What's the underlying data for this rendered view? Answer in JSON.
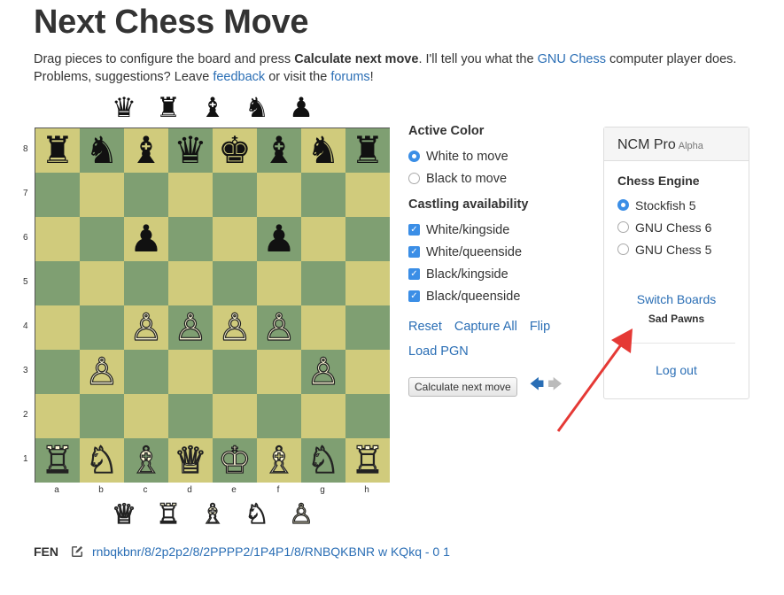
{
  "title": "Next Chess Move",
  "intro": {
    "part1": "Drag pieces to configure the board and press ",
    "bold": "Calculate next move",
    "part2": ". I'll tell you what the ",
    "gnu_link": "GNU Chess",
    "part3": " computer player does. Problems, suggestions? Leave ",
    "feedback_link": "feedback",
    "part4": " or visit the ",
    "forums_link": "forums",
    "part5": "!"
  },
  "spare_black": [
    "♛",
    "♜",
    "♝",
    "♞",
    "♟"
  ],
  "spare_white": [
    "♕",
    "♖",
    "♗",
    "♘",
    "♙"
  ],
  "board": {
    "rows": [
      [
        "♜",
        "♞",
        "♝",
        "♛",
        "♚",
        "♝",
        "♞",
        "♜"
      ],
      [
        "",
        "",
        "",
        "",
        "",
        "",
        "",
        ""
      ],
      [
        "",
        "",
        "♟",
        "",
        "",
        "♟",
        "",
        ""
      ],
      [
        "",
        "",
        "",
        "",
        "",
        "",
        "",
        ""
      ],
      [
        "",
        "",
        "♙",
        "♙",
        "♙",
        "♙",
        "",
        ""
      ],
      [
        "",
        "♙",
        "",
        "",
        "",
        "",
        "♙",
        ""
      ],
      [
        "",
        "",
        "",
        "",
        "",
        "",
        "",
        ""
      ],
      [
        "♖",
        "♘",
        "♗",
        "♕",
        "♔",
        "♗",
        "♘",
        "♖"
      ]
    ],
    "ranks": [
      "8",
      "7",
      "6",
      "5",
      "4",
      "3",
      "2",
      "1"
    ],
    "files": [
      "a",
      "b",
      "c",
      "d",
      "e",
      "f",
      "g",
      "h"
    ],
    "light_color": "#d0cb7c",
    "dark_color": "#7f9f72"
  },
  "options": {
    "active_color_title": "Active Color",
    "white_to_move": "White to move",
    "black_to_move": "Black to move",
    "castling_title": "Castling availability",
    "castling": [
      "White/kingside",
      "White/queenside",
      "Black/kingside",
      "Black/queenside"
    ],
    "reset": "Reset",
    "capture_all": "Capture All",
    "flip": "Flip",
    "load_pgn": "Load PGN",
    "calculate": "Calculate next move"
  },
  "panel": {
    "title": "NCM Pro",
    "badge": "Alpha",
    "engine_title": "Chess Engine",
    "engines": [
      "Stockfish 5",
      "GNU Chess 6",
      "GNU Chess 5"
    ],
    "selected_engine": "Stockfish 5",
    "switch_boards": "Switch Boards",
    "board_name": "Sad Pawns",
    "logout": "Log out"
  },
  "fen": {
    "label": "FEN",
    "value": "rnbqkbnr/8/2p2p2/8/2PPPP2/1P4P1/8/RNBQKBNR w KQkq - 0 1"
  },
  "colors": {
    "link": "#2a6eb5",
    "accent": "#3b8ee6",
    "annotation_arrow": "#e53935"
  }
}
